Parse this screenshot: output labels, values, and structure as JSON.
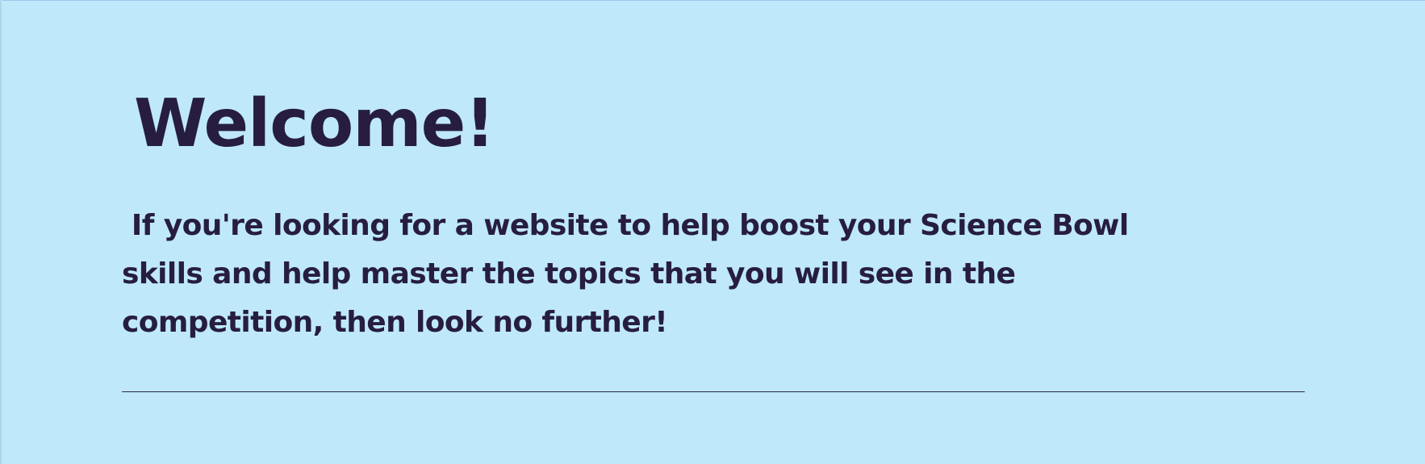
{
  "welcome": {
    "heading": "Welcome!",
    "intro_lines": [
      " If you're looking for a website to help boost your Science Bowl",
      "skills and help master the topics that you will see in the",
      "competition, then look no further!"
    ]
  },
  "colors": {
    "background": "#bfe9fa",
    "text": "#271d41",
    "divider": "#2d2756"
  }
}
